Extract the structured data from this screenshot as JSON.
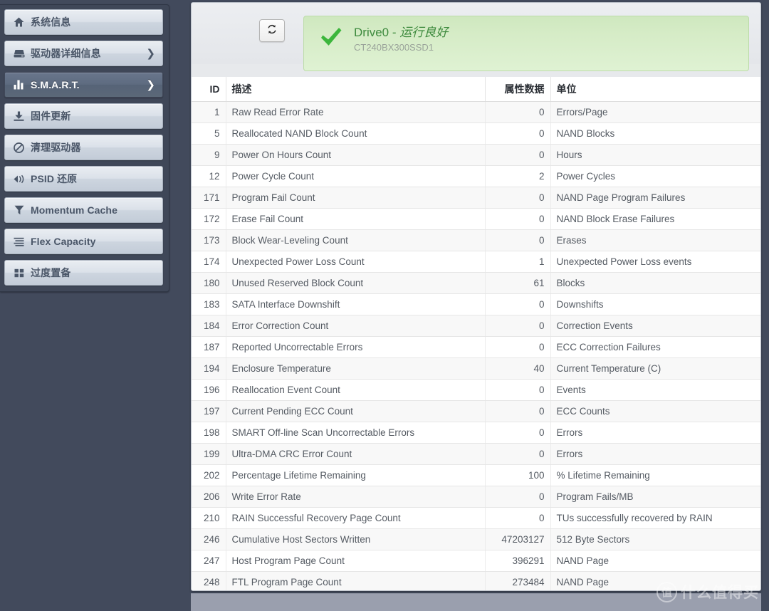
{
  "sidebar": {
    "items": [
      {
        "label": "系统信息",
        "icon": "home-icon",
        "chevron": "",
        "active": false
      },
      {
        "label": "驱动器详细信息",
        "icon": "drive-icon",
        "chevron": "❯",
        "active": false
      },
      {
        "label": "S.M.A.R.T.",
        "icon": "bar-chart-icon",
        "chevron": "❯",
        "active": true
      },
      {
        "label": "固件更新",
        "icon": "download-icon",
        "chevron": "",
        "active": false
      },
      {
        "label": "清理驱动器",
        "icon": "ban-icon",
        "chevron": "",
        "active": false
      },
      {
        "label": "PSID 还原",
        "icon": "tag-icon",
        "chevron": "",
        "active": false
      },
      {
        "label": "Momentum Cache",
        "icon": "filter-icon",
        "chevron": "",
        "active": false
      },
      {
        "label": "Flex Capacity",
        "icon": "list-icon",
        "chevron": "",
        "active": false
      },
      {
        "label": "过度置备",
        "icon": "grid-icon",
        "chevron": "",
        "active": false
      }
    ]
  },
  "header": {
    "refresh_icon": "refresh-icon",
    "status_icon": "check-icon",
    "drive_name": "Drive0 - ",
    "health": "运行良好",
    "model": "CT240BX300SSD1",
    "accent_green": "#3d8a3d",
    "card_bg": "#d6ecc7"
  },
  "table": {
    "columns": [
      "ID",
      "描述",
      "属性数据",
      "单位"
    ],
    "rows": [
      {
        "id": "1",
        "desc": "Raw Read Error Rate",
        "value": "0",
        "unit": "Errors/Page"
      },
      {
        "id": "5",
        "desc": "Reallocated NAND Block Count",
        "value": "0",
        "unit": "NAND Blocks"
      },
      {
        "id": "9",
        "desc": "Power On Hours Count",
        "value": "0",
        "unit": "Hours"
      },
      {
        "id": "12",
        "desc": "Power Cycle Count",
        "value": "2",
        "unit": "Power Cycles"
      },
      {
        "id": "171",
        "desc": "Program Fail Count",
        "value": "0",
        "unit": "NAND Page Program Failures"
      },
      {
        "id": "172",
        "desc": "Erase Fail Count",
        "value": "0",
        "unit": "NAND Block Erase Failures"
      },
      {
        "id": "173",
        "desc": "Block Wear-Leveling Count",
        "value": "0",
        "unit": "Erases"
      },
      {
        "id": "174",
        "desc": "Unexpected Power Loss Count",
        "value": "1",
        "unit": "Unexpected Power Loss events"
      },
      {
        "id": "180",
        "desc": "Unused Reserved Block Count",
        "value": "61",
        "unit": "Blocks"
      },
      {
        "id": "183",
        "desc": "SATA Interface Downshift",
        "value": "0",
        "unit": "Downshifts"
      },
      {
        "id": "184",
        "desc": "Error Correction Count",
        "value": "0",
        "unit": "Correction Events"
      },
      {
        "id": "187",
        "desc": "Reported Uncorrectable Errors",
        "value": "0",
        "unit": "ECC Correction Failures"
      },
      {
        "id": "194",
        "desc": "Enclosure Temperature",
        "value": "40",
        "unit": "Current Temperature (C)"
      },
      {
        "id": "196",
        "desc": "Reallocation Event Count",
        "value": "0",
        "unit": "Events"
      },
      {
        "id": "197",
        "desc": "Current Pending ECC Count",
        "value": "0",
        "unit": "ECC Counts"
      },
      {
        "id": "198",
        "desc": "SMART Off-line Scan Uncorrectable Errors",
        "value": "0",
        "unit": "Errors"
      },
      {
        "id": "199",
        "desc": "Ultra-DMA CRC Error Count",
        "value": "0",
        "unit": "Errors"
      },
      {
        "id": "202",
        "desc": "Percentage Lifetime Remaining",
        "value": "100",
        "unit": "% Lifetime Remaining"
      },
      {
        "id": "206",
        "desc": "Write Error Rate",
        "value": "0",
        "unit": "Program Fails/MB"
      },
      {
        "id": "210",
        "desc": "RAIN Successful Recovery Page Count",
        "value": "0",
        "unit": "TUs successfully recovered by RAIN"
      },
      {
        "id": "246",
        "desc": "Cumulative Host Sectors Written",
        "value": "47203127",
        "unit": "512 Byte Sectors"
      },
      {
        "id": "247",
        "desc": "Host Program Page Count",
        "value": "396291",
        "unit": "NAND Page"
      },
      {
        "id": "248",
        "desc": "FTL Program Page Count",
        "value": "273484",
        "unit": "NAND Page"
      }
    ]
  },
  "watermark": {
    "badge": "值",
    "text": "什么值得买"
  }
}
